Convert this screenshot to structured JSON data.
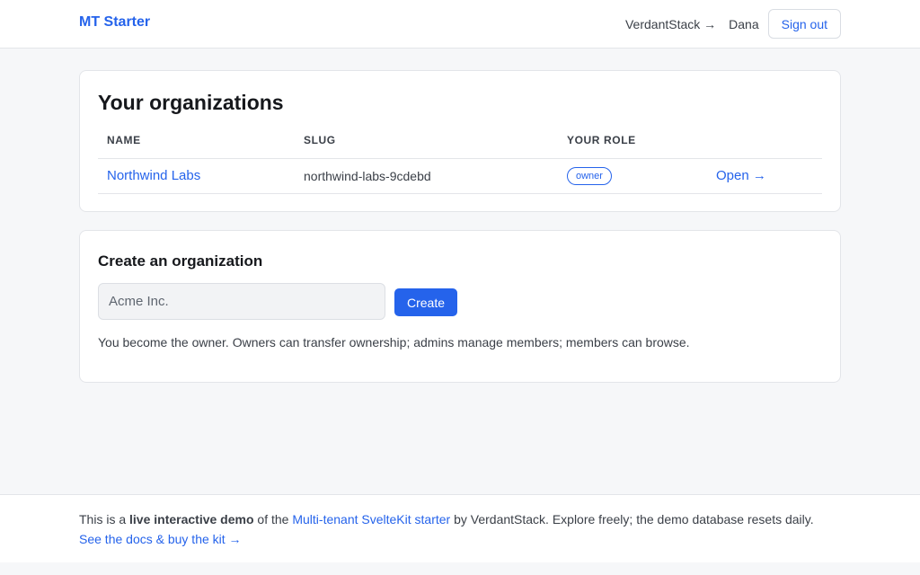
{
  "header": {
    "brand": "MT Starter",
    "vendor_link": "VerdantStack →",
    "user_name": "Dana",
    "signout_label": "Sign out"
  },
  "organizations": {
    "title": "Your organizations",
    "columns": [
      "NAME",
      "SLUG",
      "YOUR ROLE",
      ""
    ],
    "rows": [
      {
        "name": "Northwind Labs",
        "slug": "northwind-labs-9cdebd",
        "role": "owner",
        "action": "Open →"
      }
    ]
  },
  "create": {
    "title": "Create an organization",
    "input_placeholder": "Acme Inc.",
    "input_value": "",
    "button_label": "Create",
    "help_text": "You become the owner. Owners can transfer ownership; admins manage members; members can browse."
  },
  "footer": {
    "prefix": "This is a",
    "bold": "live interactive demo",
    "mid": "of the",
    "starter_link": "Multi-tenant SvelteKit starter",
    "suffix": "by VerdantStack. Explore freely; the demo database resets daily.",
    "docs_link": "See the docs & buy the kit →"
  },
  "colors": {
    "accent": "#2563eb",
    "page_bg": "#f6f7f9",
    "card_bg": "#ffffff",
    "border": "#e3e5e9"
  }
}
